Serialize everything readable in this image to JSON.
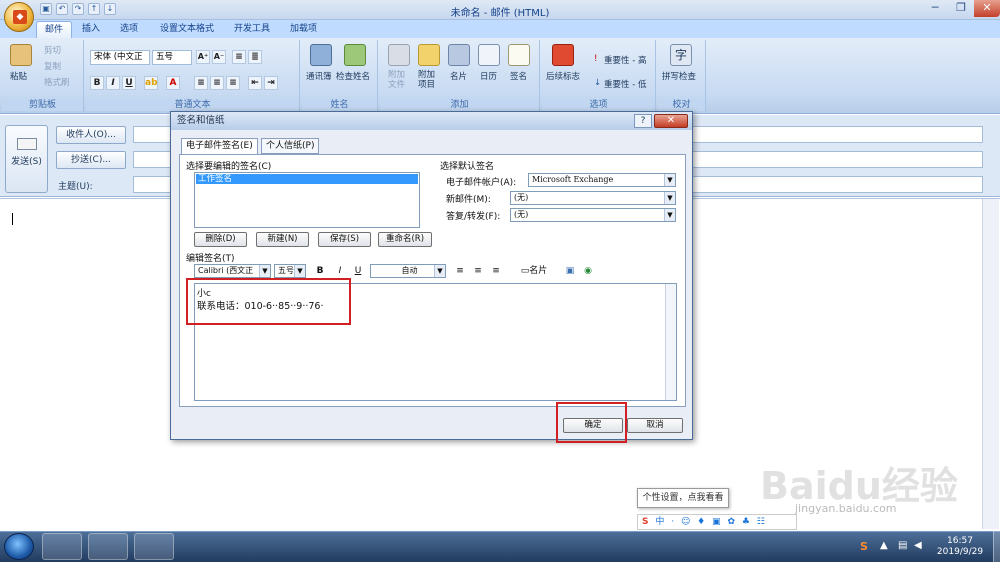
{
  "window": {
    "title": "未命名 - 邮件 (HTML)"
  },
  "quick_access": [
    "save-icon",
    "undo-icon",
    "redo-icon",
    "up-icon",
    "down-icon"
  ],
  "tabs": [
    "邮件",
    "插入",
    "选项",
    "设置文本格式",
    "开发工具",
    "加载项"
  ],
  "ribbon": {
    "clipboard": {
      "paste": "粘贴",
      "cut": "剪切",
      "copy": "复制",
      "format_painter": "格式刷",
      "label": "剪贴板"
    },
    "basic_text": {
      "font": "宋体 (中文正",
      "size": "五号",
      "label": "普通文本"
    },
    "names": {
      "address_book": "通讯簿",
      "check_names": "检查姓名",
      "label": "姓名"
    },
    "include": {
      "attach_file": "附加\n文件",
      "attach_item": "附加\n项目",
      "business_card": "名片",
      "calendar": "日历",
      "signature": "签名",
      "label": "添加"
    },
    "options": {
      "follow_up": "后续标志",
      "high": "重要性 - 高",
      "low": "重要性 - 低",
      "label": "选项"
    },
    "proofing": {
      "spelling": "拼写检查",
      "label": "校对"
    }
  },
  "header": {
    "send": "发送(S)",
    "to": "收件人(O)...",
    "cc": "抄送(C)...",
    "subject": "主题(U):"
  },
  "dialog": {
    "title": "签名和信纸",
    "help": "?",
    "tabs": [
      "电子邮件签名(E)",
      "个人信纸(P)"
    ],
    "select_label": "选择要编辑的签名(C)",
    "signatures": [
      "工作签名"
    ],
    "buttons": {
      "delete": "删除(D)",
      "new": "新建(N)",
      "save": "保存(S)",
      "rename": "重命名(R)"
    },
    "default_label": "选择默认签名",
    "account_label": "电子邮件帐户(A):",
    "account_value": "Microsoft Exchange",
    "new_msg_label": "新邮件(M):",
    "new_msg_value": "(无)",
    "reply_label": "答复/转发(F):",
    "reply_value": "(无)",
    "edit_label": "编辑签名(T)",
    "font": "Calibri (西文正",
    "size": "五号",
    "color": "自动",
    "bizcard": "名片",
    "sig_line1": "小c",
    "sig_line2": "联系电话：010-6‧‧85‧‧9‧‧76‧",
    "ok": "确定",
    "cancel": "取消"
  },
  "taskbar": {
    "time": "16:57",
    "date": "2019/9/29"
  },
  "tooltip": "个性设置，点我看看",
  "ime": "中 · ☺ ♦ ▣ ✿ ♣ ☷",
  "watermark": {
    "brand": "Baidu经验",
    "url": "jingyan.baidu.com"
  }
}
